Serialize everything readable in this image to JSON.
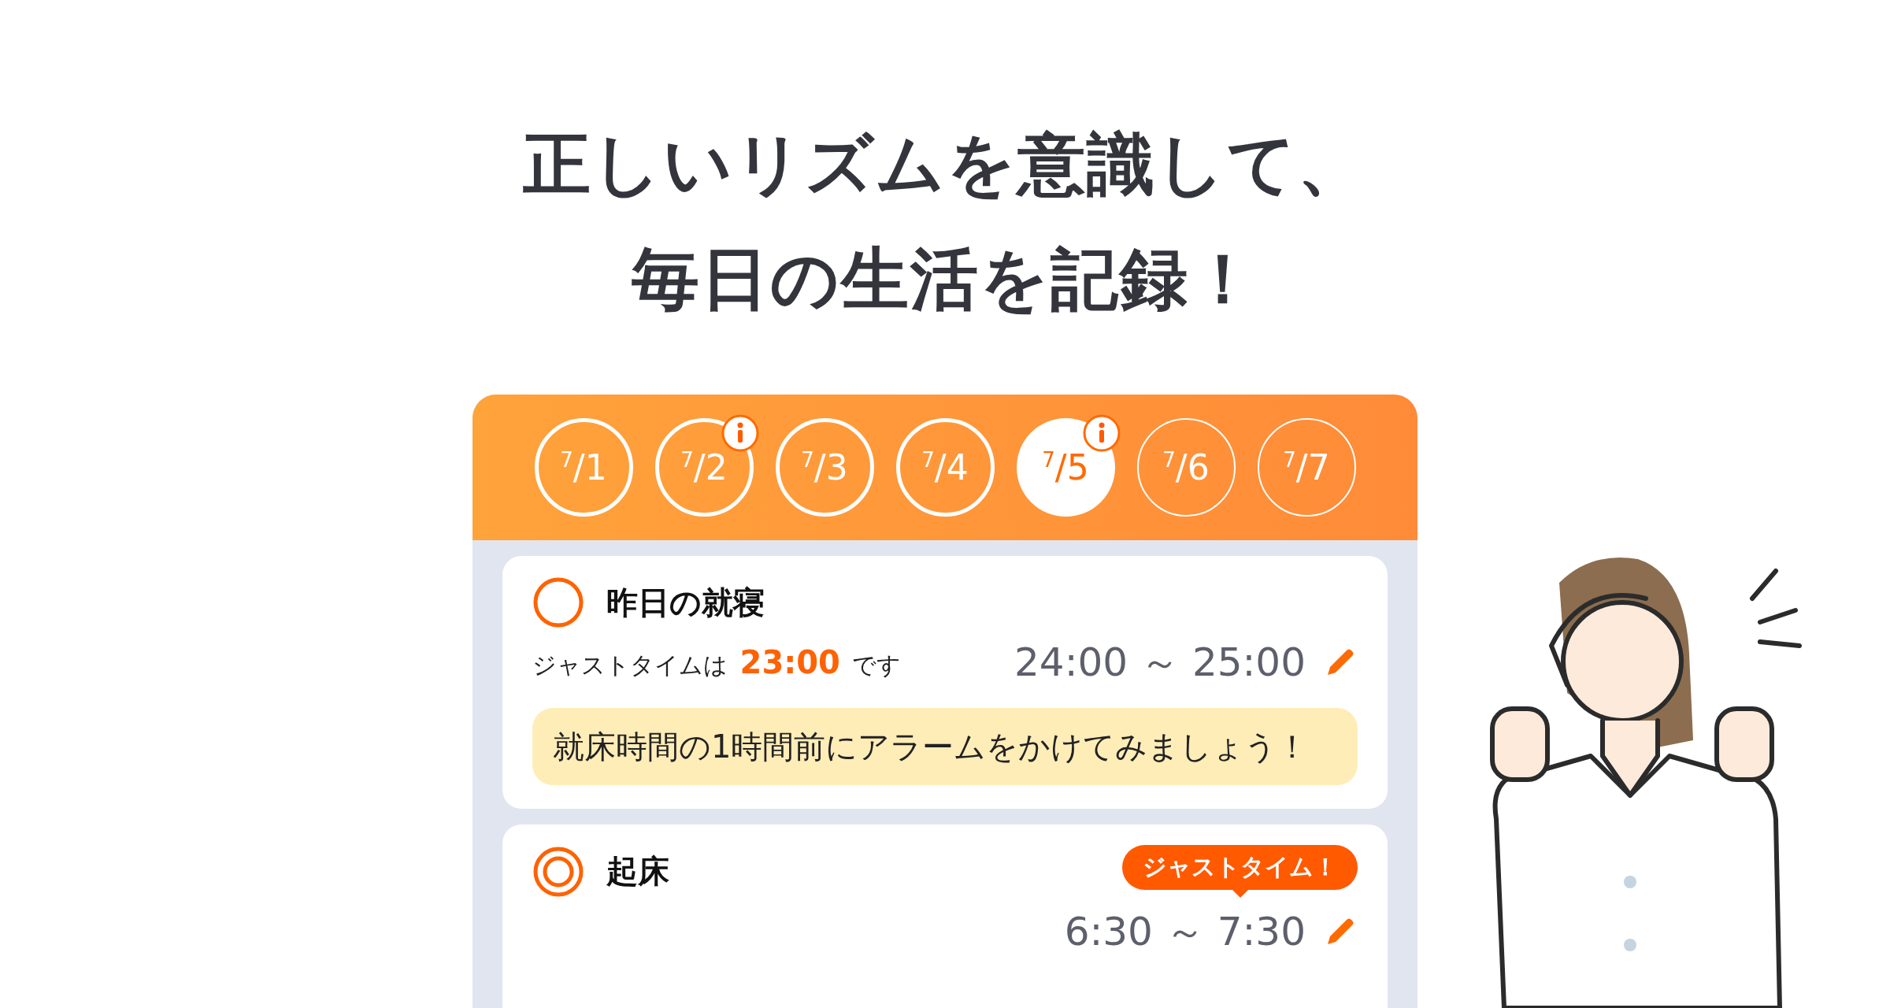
{
  "headline": [
    "正しいリズムを意識して、",
    "毎日の生活を記録！"
  ],
  "dates": [
    {
      "label": "$^{7}$/1",
      "selected": false,
      "info": false,
      "future": false
    },
    {
      "label": "$^{7}$/2",
      "selected": false,
      "info": true,
      "future": false
    },
    {
      "label": "$^{7}$/3",
      "selected": false,
      "info": false,
      "future": false
    },
    {
      "label": "$^{7}$/4",
      "selected": false,
      "info": false,
      "future": false
    },
    {
      "label": "$^{7}$/5",
      "selected": true,
      "info": true,
      "future": false
    },
    {
      "label": "$^{7}$/6",
      "selected": false,
      "info": false,
      "future": true
    },
    {
      "label": "$^{7}$/7",
      "selected": false,
      "info": false,
      "future": true
    }
  ],
  "records": [
    {
      "kind": "single",
      "title": "昨日の就寝",
      "just_time_note": "ジャストタイムは **23:00** です",
      "time_range": "24:00 ～ 25:00",
      "tip": "就床時間の1時間前にアラームをかけてみましょう！"
    },
    {
      "kind": "double",
      "title": "起床",
      "badge": "ジャストタイム！",
      "time_range": "6:30 ～ 7:30"
    }
  ]
}
